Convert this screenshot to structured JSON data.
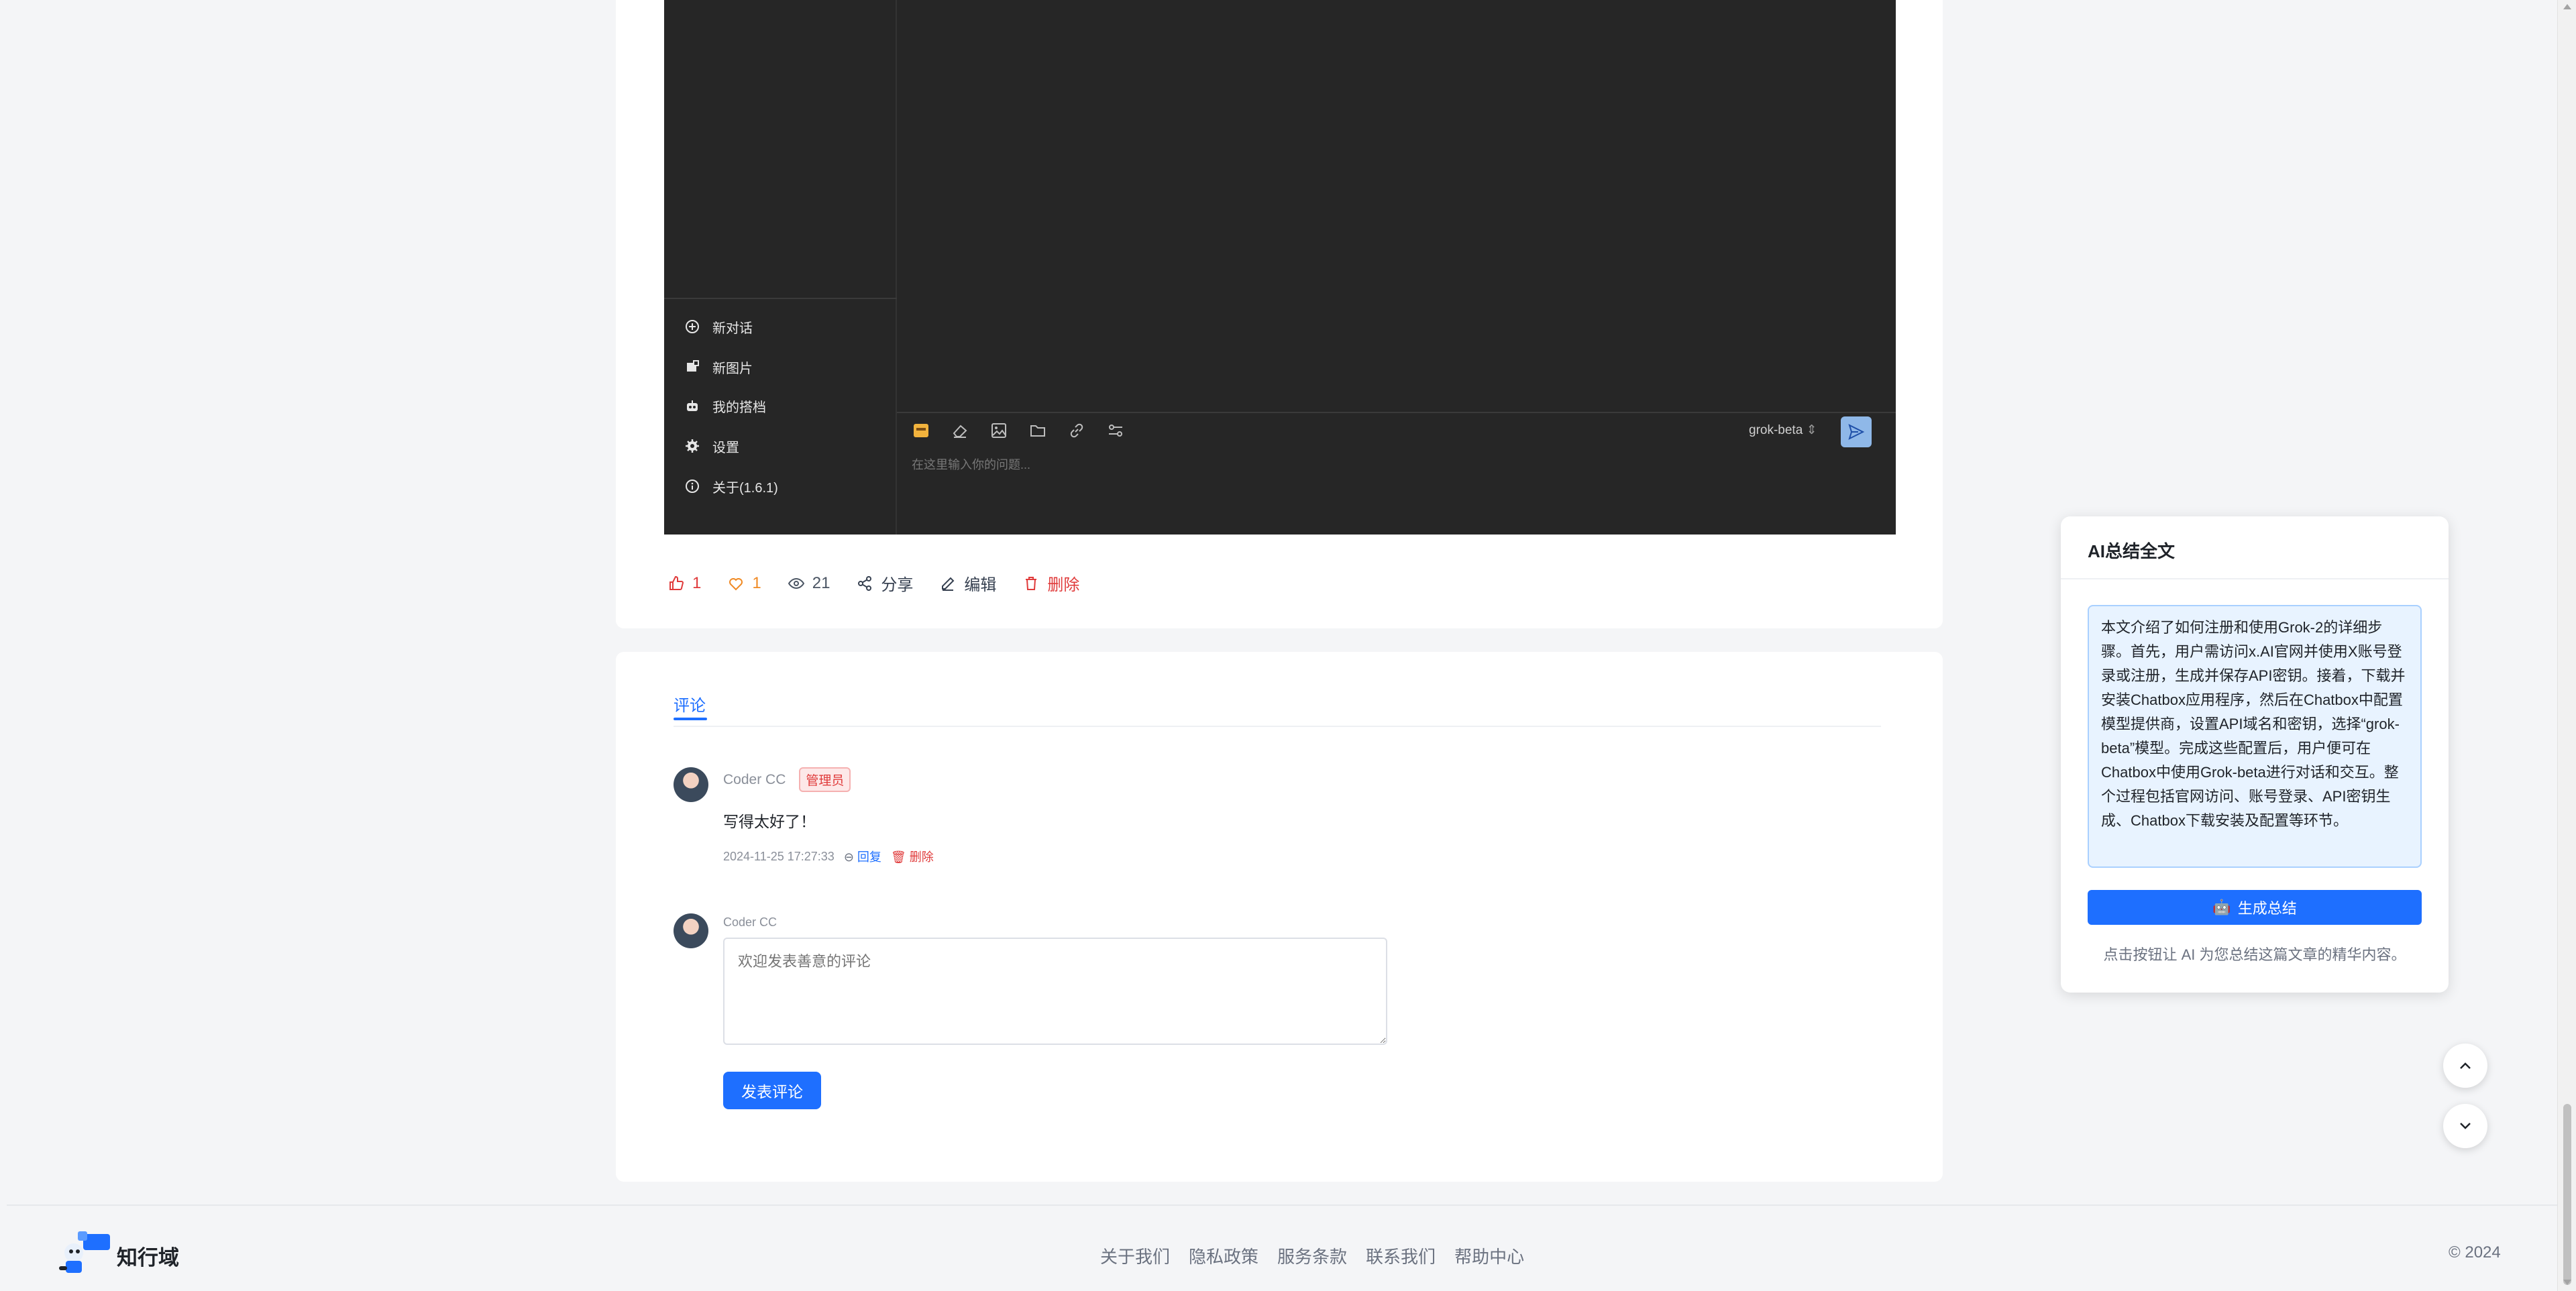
{
  "app_screenshot": {
    "menu": [
      {
        "label": "新对话",
        "icon": "plus-circle-icon"
      },
      {
        "label": "新图片",
        "icon": "image-new-icon"
      },
      {
        "label": "我的搭档",
        "icon": "robot-icon"
      },
      {
        "label": "设置",
        "icon": "gear-icon"
      },
      {
        "label": "关于(1.6.1)",
        "icon": "info-icon"
      }
    ],
    "model": "grok-beta",
    "input_placeholder": "在这里输入你的问题..."
  },
  "article_actions": {
    "likes": "1",
    "favorites": "1",
    "views": "21",
    "share_label": "分享",
    "edit_label": "编辑",
    "delete_label": "删除"
  },
  "comments": {
    "tab_label": "评论",
    "items": [
      {
        "author": "Coder CC",
        "badge": "管理员",
        "text": "写得太好了！",
        "time": "2024-11-25 17:27:33",
        "reply_label": "回复",
        "delete_label": "删除"
      }
    ],
    "composer": {
      "author": "Coder CC",
      "placeholder": "欢迎发表善意的评论",
      "submit_label": "发表评论"
    }
  },
  "ai_summary": {
    "title": "AI总结全文",
    "content": "本文介绍了如何注册和使用Grok-2的详细步骤。首先，用户需访问x.AI官网并使用X账号登录或注册，生成并保存API密钥。接着，下载并安装Chatbox应用程序，然后在Chatbox中配置模型提供商，设置API域名和密钥，选择“grok-beta”模型。完成这些配置后，用户便可在Chatbox中使用Grok-beta进行对话和交互。整个过程包括官网访问、账号登录、API密钥生成、Chatbox下载安装及配置等环节。",
    "button_label": "生成总结",
    "note": "点击按钮让 AI 为您总结这篇文章的精华内容。"
  },
  "footer": {
    "brand": "知行域",
    "links": [
      "关于我们",
      "隐私政策",
      "服务条款",
      "联系我们",
      "帮助中心"
    ],
    "copyright": "© 2024"
  },
  "colors": {
    "accent": "#1e6fff",
    "danger": "#e03b3b",
    "favorite": "#f08a24"
  }
}
